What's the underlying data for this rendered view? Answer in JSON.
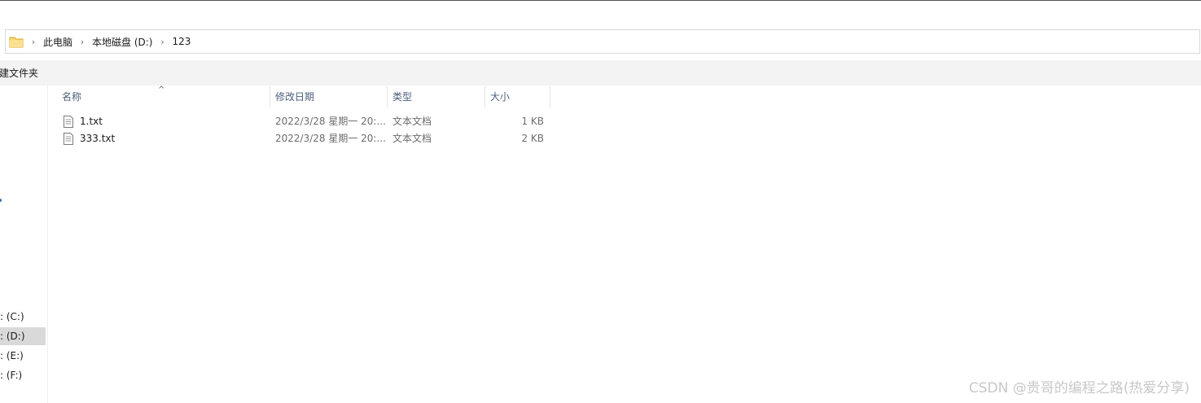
{
  "address": {
    "crumbs": [
      "此电脑",
      "本地磁盘 (D:)",
      "123"
    ]
  },
  "toolbar": {
    "new_folder_label": "建文件夹"
  },
  "sidebar": {
    "drives": [
      {
        "label": ": (C:)"
      },
      {
        "label": ": (D:)"
      },
      {
        "label": ": (E:)"
      },
      {
        "label": ": (F:)"
      }
    ]
  },
  "columns": {
    "name": "名称",
    "date": "修改日期",
    "type": "类型",
    "size": "大小",
    "sort_glyph": "^"
  },
  "files": [
    {
      "name": "1.txt",
      "date": "2022/3/28 星期一 20:...",
      "type": "文本文档",
      "size": "1 KB"
    },
    {
      "name": "333.txt",
      "date": "2022/3/28 星期一 20:...",
      "type": "文本文档",
      "size": "2 KB"
    }
  ],
  "watermark": "CSDN @贵哥的编程之路(热爱分享)",
  "colors": {
    "toolbar_bg": "#f3f3f3",
    "selected_drive_bg": "#d9d9d9",
    "folder_yellow": "#f8d775"
  }
}
